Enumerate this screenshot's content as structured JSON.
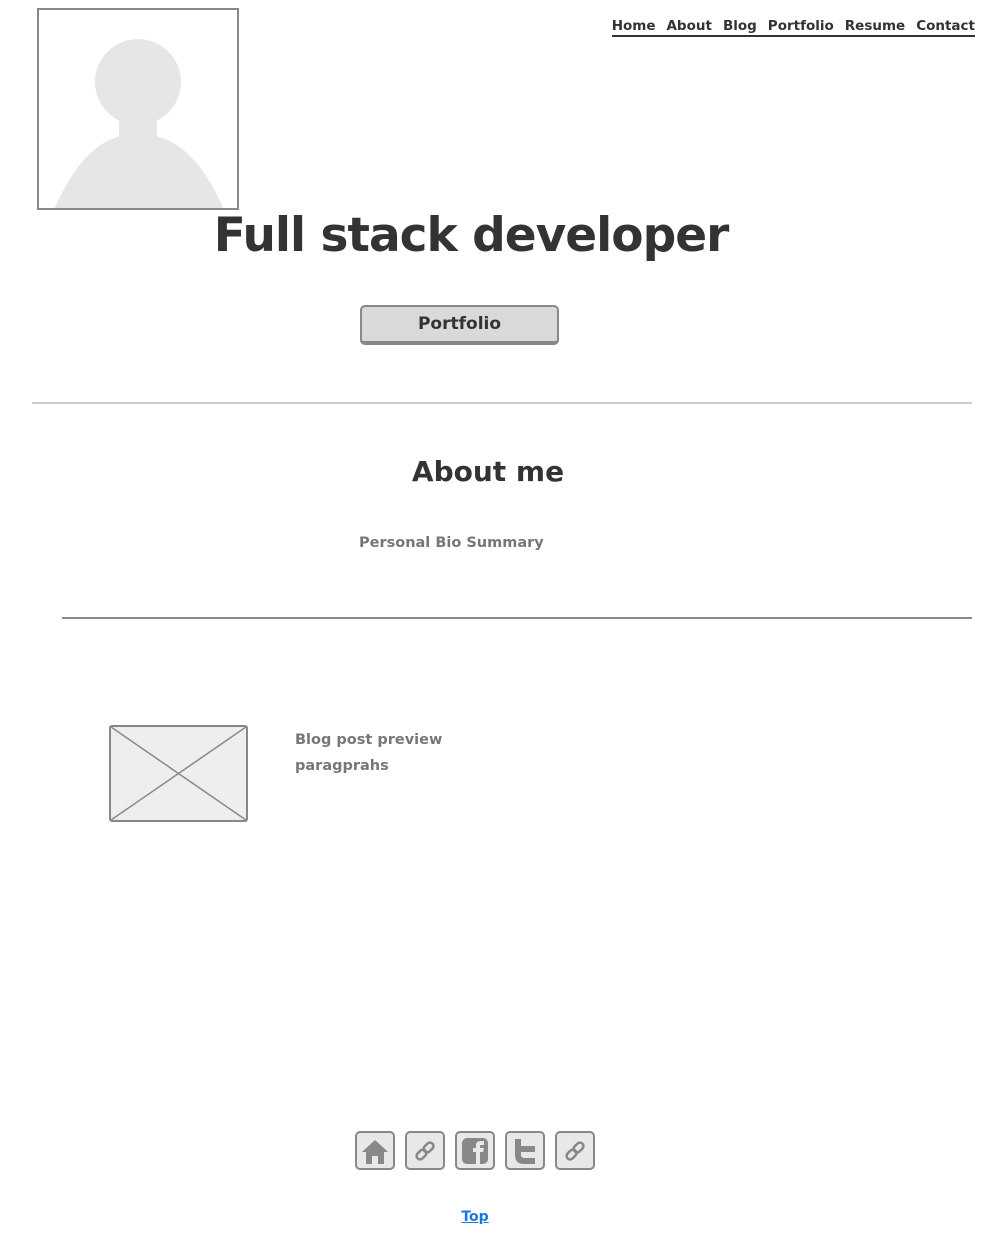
{
  "nav": {
    "items": [
      "Home",
      "About",
      "Blog",
      "Portfolio",
      "Resume",
      "Contact"
    ]
  },
  "hero": {
    "title": "Full stack developer",
    "button_label": "Portfolio"
  },
  "about": {
    "heading": "About me",
    "bio": "Personal Bio Summary"
  },
  "blog": {
    "line1": "Blog post preview",
    "line2": "paragprahs"
  },
  "footer": {
    "icons": [
      "home-icon",
      "link-icon",
      "facebook-icon",
      "twitter-icon",
      "link-icon"
    ],
    "top_link": "Top"
  },
  "colors": {
    "link": "#1a78e0",
    "wire": "#888888",
    "fill": "#e8e8e8"
  }
}
